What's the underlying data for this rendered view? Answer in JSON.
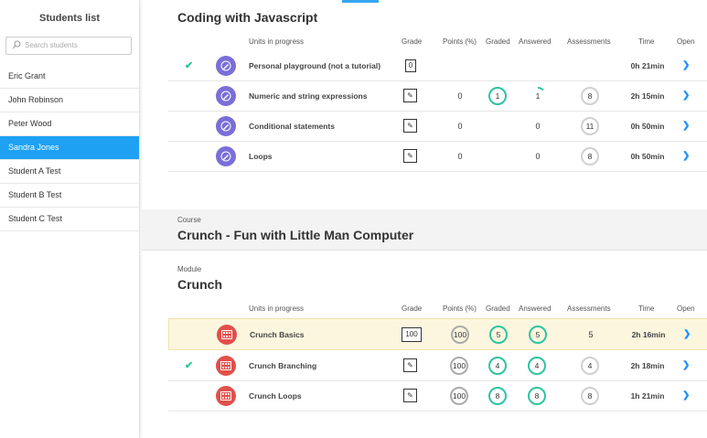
{
  "sidebar": {
    "title": "Students list",
    "search_placeholder": "Search students",
    "items": [
      {
        "label": "Eric Grant"
      },
      {
        "label": "John Robinson"
      },
      {
        "label": "Peter Wood"
      },
      {
        "label": "Sandra Jones",
        "active": true
      },
      {
        "label": "Student A Test"
      },
      {
        "label": "Student B Test"
      },
      {
        "label": "Student C Test"
      }
    ]
  },
  "columns": {
    "units": "Units in progress",
    "grade": "Grade",
    "points": "Points (%)",
    "graded": "Graded",
    "answered": "Answered",
    "assessments": "Assessments",
    "time": "Time",
    "open": "Open"
  },
  "course1": {
    "title": "Coding with Javascript",
    "units": [
      {
        "name": "Personal playground (not a tutorial)",
        "completed": true,
        "grade": "0",
        "points": "",
        "graded": "",
        "answered": "",
        "assessments": "",
        "time": "0h 21min",
        "icon": "pen-icon"
      },
      {
        "name": "Numeric and string expressions",
        "completed": false,
        "grade": "pen",
        "points": "0",
        "graded": "1",
        "answered": "1",
        "assessments": "8",
        "time": "2h 15min",
        "icon": "pen-icon"
      },
      {
        "name": "Conditional statements",
        "completed": false,
        "grade": "pen",
        "points": "0",
        "graded": "",
        "answered": "0",
        "assessments": "11",
        "time": "0h 50min",
        "icon": "pen-icon"
      },
      {
        "name": "Loops",
        "completed": false,
        "grade": "pen",
        "points": "0",
        "graded": "",
        "answered": "0",
        "assessments": "8",
        "time": "0h 50min",
        "icon": "pen-icon"
      }
    ]
  },
  "course2": {
    "label": "Course",
    "title": "Crunch - Fun with Little Man Computer",
    "module_label": "Module",
    "module_title": "Crunch",
    "units": [
      {
        "name": "Crunch Basics",
        "completed": false,
        "grade": "100",
        "points": "100",
        "graded": "5",
        "answered": "5",
        "assessments": "5",
        "time": "2h 16min",
        "highlight": true,
        "icon": "calculator-icon"
      },
      {
        "name": "Crunch Branching",
        "completed": true,
        "grade": "pen",
        "points": "100",
        "graded": "4",
        "answered": "4",
        "assessments": "4",
        "time": "2h 18min",
        "icon": "calculator-icon"
      },
      {
        "name": "Crunch Loops",
        "completed": false,
        "grade": "pen",
        "points": "100",
        "graded": "8",
        "answered": "8",
        "assessments": "8",
        "time": "1h 21min",
        "icon": "calculator-icon"
      }
    ]
  },
  "colors": {
    "accent": "#1ea1f2",
    "green": "#2ec4a0",
    "js_icon": "#7a6ed8",
    "lmc_icon": "#e2504a",
    "highlight_row": "#fdf6df"
  }
}
